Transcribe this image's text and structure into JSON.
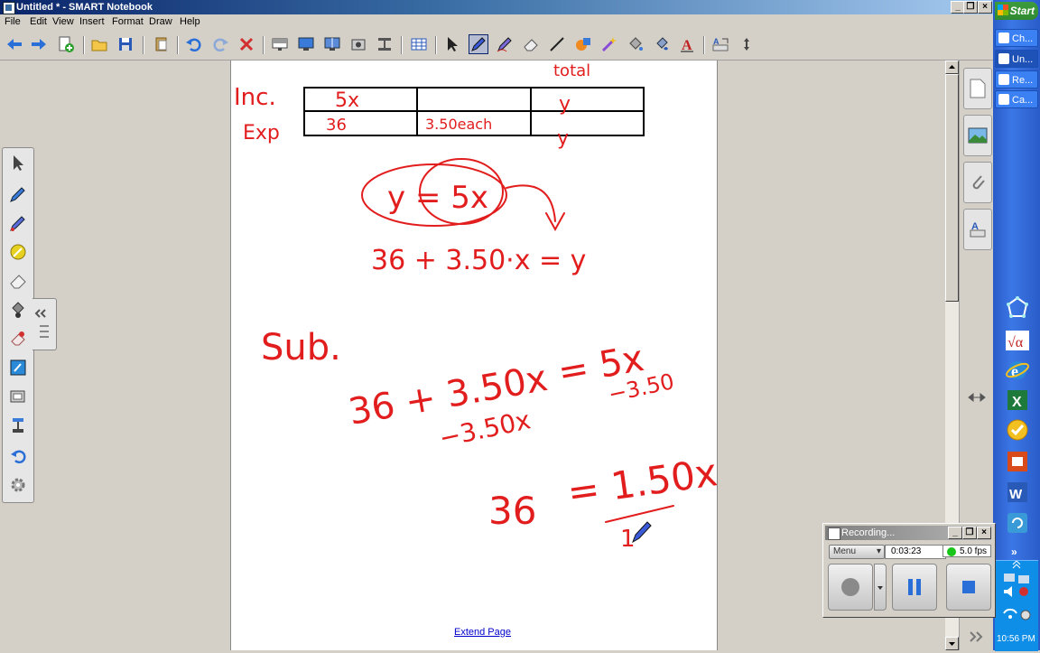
{
  "window": {
    "title": "Untitled * - SMART Notebook",
    "controls": {
      "minimize": "_",
      "restore": "❐",
      "close": "×"
    }
  },
  "menu": [
    "File",
    "Edit",
    "View",
    "Insert",
    "Format",
    "Draw",
    "Help"
  ],
  "toolbar": {
    "icons": [
      "back-arrow-icon",
      "forward-arrow-icon",
      "add-page-icon",
      "open-folder-icon",
      "save-icon",
      "paste-icon",
      "undo-icon",
      "redo-icon",
      "delete-icon",
      "screen-shade-icon",
      "full-screen-icon",
      "dual-page-icon",
      "screen-capture-icon",
      "document-camera-icon",
      "table-icon",
      "select-arrow-icon",
      "pen-icon",
      "creative-pen-icon",
      "eraser-icon",
      "line-icon",
      "shape-icon",
      "magic-pen-icon",
      "fill-icon",
      "text-icon",
      "properties-icon",
      "move-toolbar-icon"
    ]
  },
  "page": {
    "extend_link": "Extend Page",
    "ink_color": "#e21d1d",
    "handwriting": {
      "row1_label": "Inc.",
      "row2_label": "Exp",
      "header_total": "total",
      "cell_r1c1": "5x",
      "cell_r1c3": "y",
      "cell_r2c1": "36",
      "cell_r2c2": "3.50each",
      "cell_r2c3": "y",
      "eq1": "y = 5x",
      "eq2": "36 + 3.50·x = y",
      "sub_label": "Sub.",
      "eq3_left": "36 + 3.50x",
      "eq3_right": "= 5x",
      "eq3_sub_left": "−3.50x",
      "eq3_sub_right": "−3.50",
      "eq4_left": "36",
      "eq4_right": "= 1.50x",
      "eq4_divisor": "1"
    }
  },
  "palette": {
    "icons": [
      "select-icon",
      "pen-icon",
      "marker-icon",
      "highlighter-icon",
      "eraser-icon",
      "fill-icon",
      "magic-eraser-icon",
      "notebook-icon",
      "screen-capture-icon",
      "recorder-icon",
      "undo-icon",
      "settings-icon"
    ]
  },
  "sidetabs": [
    "page-sorter-icon",
    "gallery-icon",
    "attachments-icon",
    "properties-icon"
  ],
  "taskbar": {
    "start": "Start",
    "tasks": [
      {
        "label": "Ch...",
        "active": false
      },
      {
        "label": "Un...",
        "active": true
      },
      {
        "label": "Re...",
        "active": false
      },
      {
        "label": "Ca...",
        "active": false
      }
    ],
    "quicklaunch": [
      "polygon-icon",
      "equation-icon",
      "internet-explorer-icon",
      "excel-icon",
      "outlook-icon",
      "access-icon",
      "word-icon",
      "refresh-icon"
    ],
    "expand": "»",
    "clock": "10:56 PM"
  },
  "recorder": {
    "title": "Recording...",
    "menu_label": "Menu",
    "time": "0:03:23",
    "fps": "5.0 fps",
    "record_status_color": "#19c519"
  }
}
